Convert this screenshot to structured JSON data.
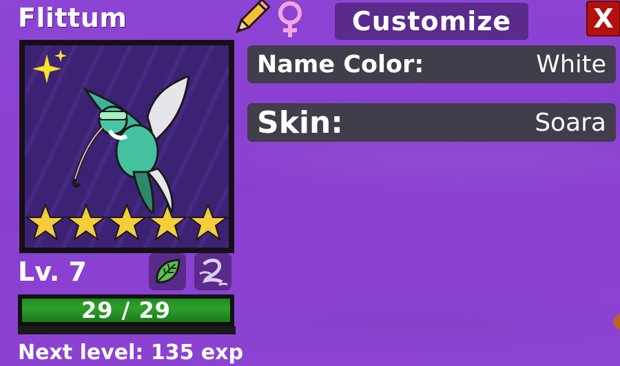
{
  "creature": {
    "name": "Flittum",
    "level_text": "Lv. 7",
    "hp_text": "29 / 29",
    "hp_fraction": 1.0,
    "next_level_text": "Next level: 135 exp",
    "stars": 5,
    "type_badges": [
      "leaf-icon",
      "wind-icon"
    ],
    "sparkle": "sparkle-icon"
  },
  "header": {
    "rename_icon": "pencil-icon",
    "gender_icon": "female-icon",
    "customize_label": "Customize",
    "close_label": "X"
  },
  "options": {
    "name_color": {
      "label": "Name Color:",
      "value": "White"
    },
    "skin": {
      "label": "Skin:",
      "value": "Soara"
    }
  },
  "colors": {
    "background": "#8a3fd0",
    "panel": "#413d4a",
    "button": "#5a2a8c",
    "close": "#b31010",
    "hp": "#2da02b",
    "star": "#f5cc3a",
    "gender": "#f3a6e0"
  }
}
